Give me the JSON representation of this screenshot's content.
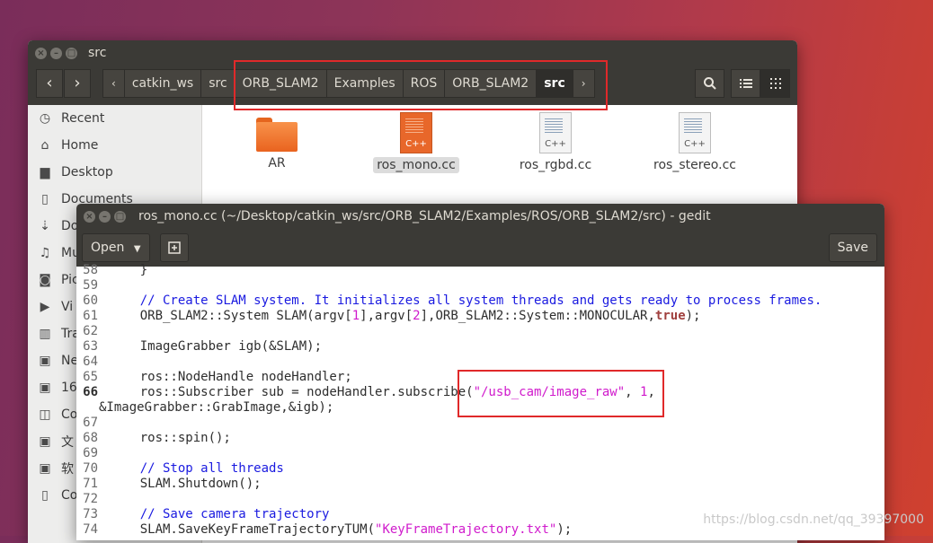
{
  "file_manager": {
    "title": "src",
    "breadcrumbs": [
      "catkin_ws",
      "src",
      "ORB_SLAM2",
      "Examples",
      "ROS",
      "ORB_SLAM2",
      "src"
    ],
    "sidebar": [
      "Recent",
      "Home",
      "Desktop",
      "Documents",
      "Do",
      "Mu",
      "Pic",
      "Vi",
      "Tra",
      "Ne",
      "16",
      "Co",
      "文",
      "软",
      "Co"
    ],
    "files": [
      {
        "name": "AR",
        "type": "folder"
      },
      {
        "name": "ros_mono.cc",
        "type": "cpp"
      },
      {
        "name": "ros_rgbd.cc",
        "type": "cpp"
      },
      {
        "name": "ros_stereo.cc",
        "type": "cpp"
      }
    ],
    "cpp_badge": "C++"
  },
  "gedit": {
    "title": "ros_mono.cc (~/Desktop/catkin_ws/src/ORB_SLAM2/Examples/ROS/ORB_SLAM2/src) - gedit",
    "open_label": "Open",
    "save_label": "Save",
    "lines": [
      {
        "n": "58",
        "code": "    }"
      },
      {
        "n": "59",
        "code": ""
      },
      {
        "n": "60",
        "code": "    // Create SLAM system. It initializes all system threads and gets ready to process frames."
      },
      {
        "n": "61",
        "pre": "    ORB_SLAM2::System SLAM(argv[",
        "a": "1",
        "mid": "],argv[",
        "b": "2",
        "post": "],ORB_SLAM2::System::MONOCULAR,",
        "kw": "true",
        "end": ");"
      },
      {
        "n": "62",
        "code": ""
      },
      {
        "n": "63",
        "code": "    ImageGrabber igb(&SLAM);"
      },
      {
        "n": "64",
        "code": ""
      },
      {
        "n": "65",
        "code": "    ros::NodeHandle nodeHandler;"
      },
      {
        "n": "66",
        "pre": "    ros::Subscriber sub = nodeHandler.subscribe(",
        "str": "\"/usb_cam/image_raw\"",
        "mid": ", ",
        "num": "1",
        "end": ","
      },
      {
        "n": "",
        "code": "&ImageGrabber::GrabImage,&igb);"
      },
      {
        "n": "67",
        "code": ""
      },
      {
        "n": "68",
        "code": "    ros::spin();"
      },
      {
        "n": "69",
        "code": ""
      },
      {
        "n": "70",
        "code": "    // Stop all threads"
      },
      {
        "n": "71",
        "code": "    SLAM.Shutdown();"
      },
      {
        "n": "72",
        "code": ""
      },
      {
        "n": "73",
        "code": "    // Save camera trajectory"
      },
      {
        "n": "74",
        "pre": "    SLAM.SaveKeyFrameTrajectoryTUM(",
        "str": "\"KeyFrameTrajectory.txt\"",
        "end": ");"
      }
    ]
  },
  "watermark": "https://blog.csdn.net/qq_39397000"
}
